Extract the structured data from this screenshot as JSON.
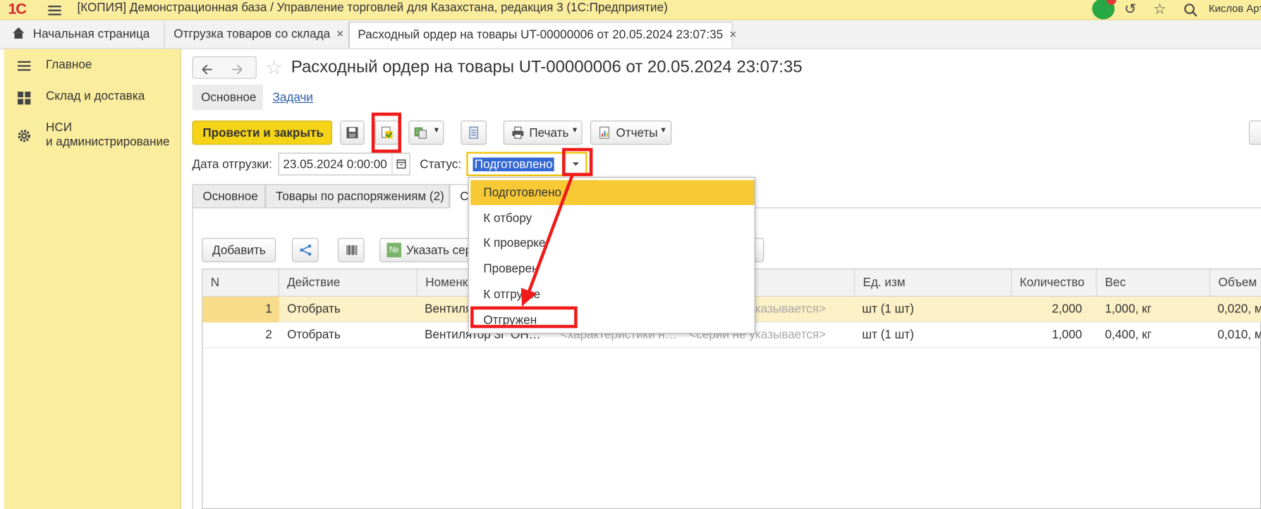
{
  "app": {
    "logo_text": "1С",
    "title": "[КОПИЯ] Демонстрационная база / Управление торговлей для Казахстана, редакция 3  (1С:Предприятие)",
    "user": "Кислов Арте",
    "notification_count": "1"
  },
  "window_tabs": [
    {
      "label": "Начальная страница"
    },
    {
      "label": "Отгрузка товаров со склада",
      "close": "×"
    },
    {
      "label": "Расходный ордер на товары UT-00000006 от 20.05.2024 23:07:35",
      "close": "×"
    }
  ],
  "sidebar": {
    "items": [
      {
        "label": "Главное",
        "icon": "list-icon"
      },
      {
        "label": "Склад и доставка",
        "icon": "grid-icon"
      },
      {
        "label": "НСИ",
        "label2": "и администрирование",
        "icon": "gear-icon"
      }
    ]
  },
  "document": {
    "title": "Расходный ордер на товары UT-00000006 от 20.05.2024 23:07:35",
    "form_tabs": [
      "Основное",
      "Задачи"
    ]
  },
  "toolbar": {
    "post_close": "Провести и закрыть",
    "print": "Печать",
    "reports": "Отчеты"
  },
  "fields": {
    "ship_date_label": "Дата отгрузки:",
    "ship_date_value": "23.05.2024  0:00:00",
    "status_label": "Статус:",
    "status_value": "Подготовлено"
  },
  "page_tabs": [
    "Основное",
    "Товары по распоряжениям (2)",
    "С"
  ],
  "table_toolbar": {
    "add": "Добавить",
    "serial": "Указать сер"
  },
  "grid": {
    "columns": [
      "N",
      "Действие",
      "Номенк",
      "Ед. изм",
      "Количество",
      "Вес",
      "Объем"
    ],
    "rows": [
      {
        "n": "1",
        "action": "Отобрать",
        "item": "Вентиля",
        "series": "казывается>",
        "unit": "шт (1 шт)",
        "qty": "2,000",
        "weight": "1,000, кг",
        "volume": "0,020, м"
      },
      {
        "n": "2",
        "action": "Отобрать",
        "item": "Вентилятор 3Г ОН…",
        "characteristic": "<характеристики н…",
        "series": "<серии не указывается>",
        "unit": "шт (1 шт)",
        "qty": "1,000",
        "weight": "0,400, кг",
        "volume": "0,010, м"
      }
    ]
  },
  "status_dropdown": {
    "options": [
      "Подготовлено",
      "К отбору",
      "К проверке",
      "Проверен",
      "К отгрузке",
      "Отгружен"
    ],
    "highlighted": "Подготовлено"
  },
  "colors": {
    "accent_yellow": "#f5d418",
    "sidebar_bg": "#fbed9e",
    "annotation_red": "#f01a1a",
    "link_blue": "#2b5ba8"
  }
}
